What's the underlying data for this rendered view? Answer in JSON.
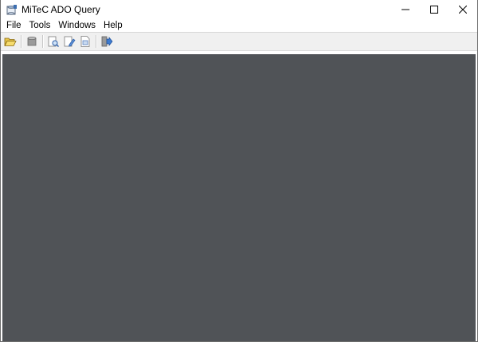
{
  "window": {
    "title": "MiTeC ADO Query",
    "app_icon": "database-app-icon"
  },
  "caption_buttons": [
    {
      "name": "minimize-button",
      "icon": "minimize-icon"
    },
    {
      "name": "maximize-button",
      "icon": "maximize-icon"
    },
    {
      "name": "close-button",
      "icon": "close-icon"
    }
  ],
  "menu": {
    "file": "File",
    "tools": "Tools",
    "windows": "Windows",
    "help": "Help"
  },
  "toolbar": {
    "items": [
      "open-folder-icon",
      "disconnect-database-icon",
      "query-icon",
      "edit-query-icon",
      "new-document-icon",
      "exit-icon"
    ]
  },
  "colors": {
    "mdi_background": "#505357",
    "toolbar_background": "#f0f0f0",
    "title_background": "#ffffff"
  }
}
